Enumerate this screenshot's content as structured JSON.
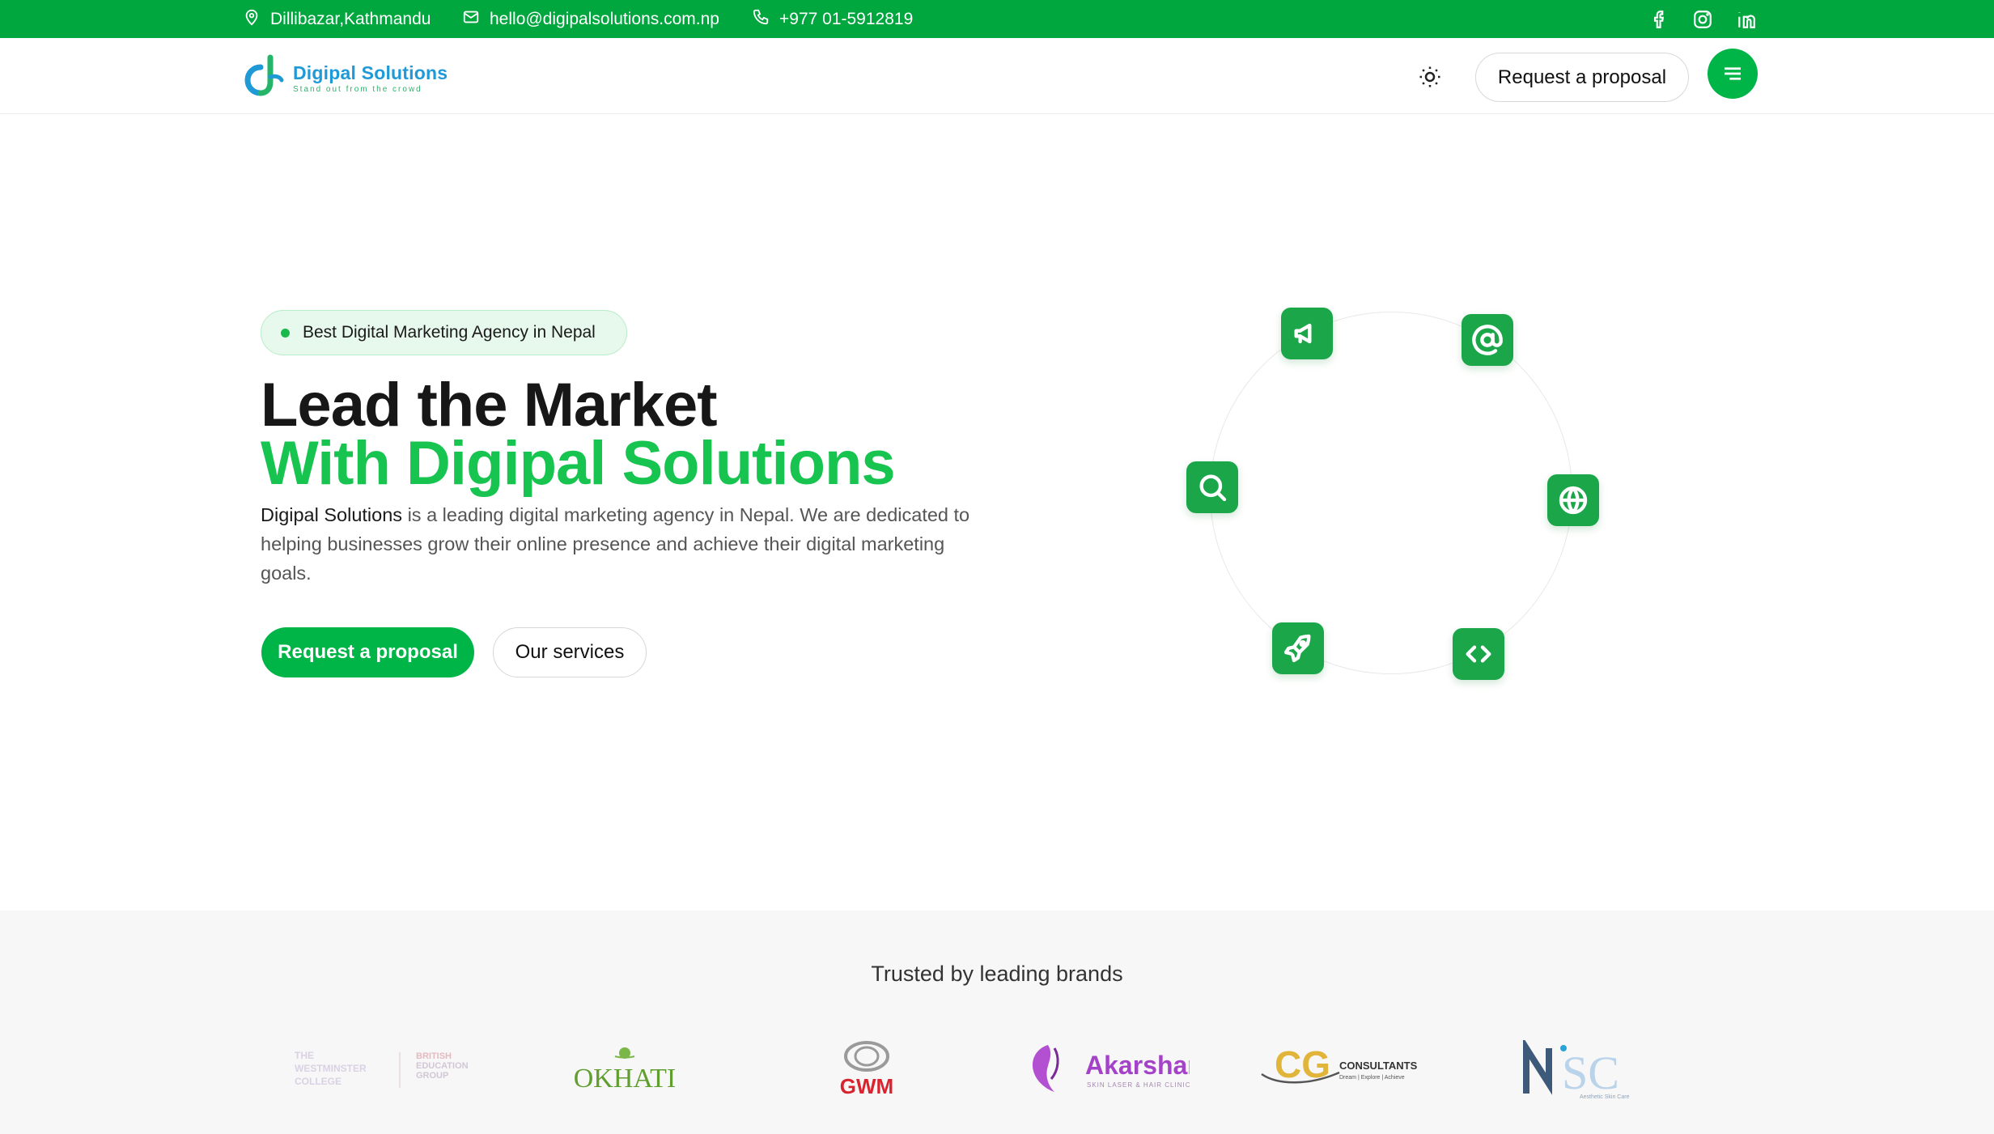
{
  "topbar": {
    "address": "Dillibazar,Kathmandu",
    "email": "hello@digipalsolutions.com.np",
    "phone": "+977 01-5912819",
    "socials": [
      "facebook-icon",
      "instagram-icon",
      "linkedin-icon"
    ]
  },
  "header": {
    "logo_name": "Digipal Solutions",
    "logo_tagline": "Stand out from the crowd",
    "proposal_label": "Request a proposal"
  },
  "hero": {
    "badge": "Best Digital Marketing Agency in Nepal",
    "title_line1": "Lead the Market",
    "title_line2": "With Digipal Solutions",
    "desc_strong": "Digipal Solutions",
    "desc_rest": " is a leading digital marketing agency in Nepal. We are dedicated to helping businesses grow their online presence and achieve their digital marketing goals.",
    "cta_primary": "Request a proposal",
    "cta_secondary": "Our services",
    "orbit_icons": [
      "megaphone-icon",
      "at-icon",
      "globe-icon",
      "code-icon",
      "rocket-icon",
      "search-icon"
    ]
  },
  "brands": {
    "title": "Trusted by leading brands",
    "logos": [
      {
        "name": "westminster",
        "text1": "THE WESTMINSTER COLLEGE",
        "text2": "BRITISH EDUCATION GROUP"
      },
      {
        "name": "okhati",
        "text": "OKHATI"
      },
      {
        "name": "gwm",
        "text": "GWM"
      },
      {
        "name": "akarshan",
        "text": "Akarshan",
        "sub": "SKIN LASER & HAIR CLINIC"
      },
      {
        "name": "cg-consultants",
        "text": "CG",
        "sub": "CONSULTANTS",
        "sub2": "Dream | Explore | Achieve"
      },
      {
        "name": "nsc",
        "text": "NSC",
        "sub": "Aesthetic Skin Care"
      }
    ]
  },
  "colors": {
    "primary_green": "#00a63e",
    "bright_green": "#17c44f",
    "logo_blue": "#1f9ad6"
  }
}
